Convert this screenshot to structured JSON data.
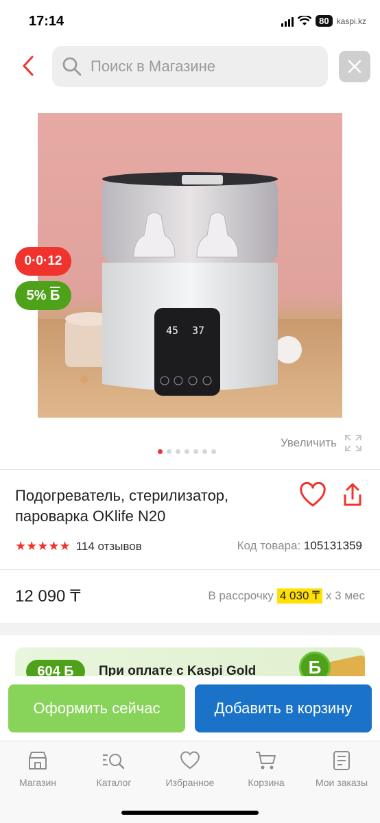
{
  "status": {
    "time": "17:14",
    "battery": "80",
    "carrier": "kaspi.kz"
  },
  "search": {
    "placeholder": "Поиск в Магазине"
  },
  "badges": {
    "installment": "0·0·12",
    "bonus": "5%",
    "bonus_currency": "Б"
  },
  "gallery": {
    "zoom_label": "Увеличить",
    "dot_count": 7,
    "active_index": 0
  },
  "product": {
    "title": "Подогреватель, стерилизатор, пароварка OKlife N20",
    "rating_stars": 5,
    "reviews": "114 отзывов",
    "code_label": "Код товара:",
    "code_value": "105131359",
    "price": "12 090 ₸"
  },
  "installment": {
    "prefix": "В рассрочку",
    "amount": "4 030 ₸",
    "suffix": "x 3 мес"
  },
  "promo": {
    "badge": "604 Б",
    "text": "При оплате с Kaspi Gold",
    "coin": "Б"
  },
  "actions": {
    "checkout": "Оформить сейчас",
    "add_to_cart": "Добавить в корзину"
  },
  "tabs": [
    {
      "label": "Магазин",
      "icon": "store-icon"
    },
    {
      "label": "Каталог",
      "icon": "catalog-icon"
    },
    {
      "label": "Избранное",
      "icon": "heart-icon"
    },
    {
      "label": "Корзина",
      "icon": "cart-icon"
    },
    {
      "label": "Мои заказы",
      "icon": "orders-icon"
    }
  ],
  "colors": {
    "accent_red": "#f0332c",
    "bonus_green": "#4ea21a",
    "checkout_green": "#88d45a",
    "cart_blue": "#1a73c8",
    "installment_yellow": "#ffe000"
  }
}
